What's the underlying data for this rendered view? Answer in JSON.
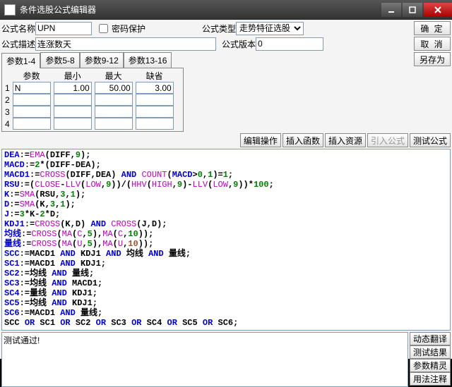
{
  "window_title": "条件选股公式编辑器",
  "top": {
    "name_label": "公式名称",
    "name_value": "UPN",
    "pwd_label": "密码保护",
    "type_label": "公式类型",
    "type_value": "走势特征选股",
    "desc_label": "公式描述",
    "desc_value": "连涨数天",
    "ver_label": "公式版本",
    "ver_value": "0"
  },
  "right_buttons": {
    "ok": "确 定",
    "cancel": "取 消",
    "saveas": "另存为"
  },
  "tabs": [
    "参数1-4",
    "参数5-8",
    "参数9-12",
    "参数13-16"
  ],
  "param_headers": [
    "参数",
    "最小",
    "最大",
    "缺省"
  ],
  "param_rows": [
    {
      "ix": "1",
      "name": "N",
      "min": "1.00",
      "max": "50.00",
      "def": "3.00"
    },
    {
      "ix": "2",
      "name": "",
      "min": "",
      "max": "",
      "def": ""
    },
    {
      "ix": "3",
      "name": "",
      "min": "",
      "max": "",
      "def": ""
    },
    {
      "ix": "4",
      "name": "",
      "min": "",
      "max": "",
      "def": ""
    }
  ],
  "mid_buttons": [
    "编辑操作",
    "插入函数",
    "插入资源",
    "引入公式",
    "测试公式"
  ],
  "mid_disabled_index": 3,
  "output_text": "测试通过!",
  "side_buttons": [
    "动态翻译",
    "测试结果",
    "参数精灵",
    "用法注释"
  ],
  "code_lines": [
    [
      [
        "kw",
        "DEA"
      ],
      [
        "bk",
        ":="
      ],
      [
        "fn",
        "EMA"
      ],
      [
        "bk",
        "(DIFF,"
      ],
      [
        "gn",
        "9"
      ],
      [
        "bk",
        ");"
      ]
    ],
    [
      [
        "kw",
        "MACD"
      ],
      [
        "bk",
        ":="
      ],
      [
        "gn",
        "2"
      ],
      [
        "bk",
        "*(DIFF-DEA);"
      ]
    ],
    [
      [
        "kw",
        "MACD1"
      ],
      [
        "bk",
        ":="
      ],
      [
        "fn",
        "CROSS"
      ],
      [
        "bk",
        "(DIFF,DEA) "
      ],
      [
        "kw",
        "AND"
      ],
      [
        "bk",
        " "
      ],
      [
        "fn",
        "COUNT"
      ],
      [
        "bk",
        "("
      ],
      [
        "kw",
        "MACD"
      ],
      [
        "bk",
        ">"
      ],
      [
        "gn",
        "0"
      ],
      [
        "bk",
        ","
      ],
      [
        "gn",
        "1"
      ],
      [
        "bk",
        ")="
      ],
      [
        "gn",
        "1"
      ],
      [
        "bk",
        ";"
      ]
    ],
    [
      [
        "kw",
        "RSU"
      ],
      [
        "bk",
        ":=("
      ],
      [
        "fn",
        "CLOSE"
      ],
      [
        "bk",
        "-"
      ],
      [
        "fn",
        "LLV"
      ],
      [
        "bk",
        "("
      ],
      [
        "fn",
        "LOW"
      ],
      [
        "bk",
        ","
      ],
      [
        "gn",
        "9"
      ],
      [
        "bk",
        "))/("
      ],
      [
        "fn",
        "HHV"
      ],
      [
        "bk",
        "("
      ],
      [
        "fn",
        "HIGH"
      ],
      [
        "bk",
        ","
      ],
      [
        "gn",
        "9"
      ],
      [
        "bk",
        ")-"
      ],
      [
        "fn",
        "LLV"
      ],
      [
        "bk",
        "("
      ],
      [
        "fn",
        "LOW"
      ],
      [
        "bk",
        ","
      ],
      [
        "gn",
        "9"
      ],
      [
        "bk",
        "))*"
      ],
      [
        "gn",
        "100"
      ],
      [
        "bk",
        ";"
      ]
    ],
    [
      [
        "kw",
        "K"
      ],
      [
        "bk",
        ":="
      ],
      [
        "fn",
        "SMA"
      ],
      [
        "bk",
        "(RSU,"
      ],
      [
        "gn",
        "3"
      ],
      [
        "bk",
        ","
      ],
      [
        "gn",
        "1"
      ],
      [
        "bk",
        ");"
      ]
    ],
    [
      [
        "kw",
        "D"
      ],
      [
        "bk",
        ":="
      ],
      [
        "fn",
        "SMA"
      ],
      [
        "bk",
        "(K,"
      ],
      [
        "gn",
        "3"
      ],
      [
        "bk",
        ","
      ],
      [
        "gn",
        "1"
      ],
      [
        "bk",
        ");"
      ]
    ],
    [
      [
        "kw",
        "J"
      ],
      [
        "bk",
        ":="
      ],
      [
        "gn",
        "3"
      ],
      [
        "bk",
        "*K-"
      ],
      [
        "gn",
        "2"
      ],
      [
        "bk",
        "*D;"
      ]
    ],
    [
      [
        "kw",
        "KDJ1"
      ],
      [
        "bk",
        ":="
      ],
      [
        "fn",
        "CROSS"
      ],
      [
        "bk",
        "(K,D) "
      ],
      [
        "kw",
        "AND"
      ],
      [
        "bk",
        " "
      ],
      [
        "fn",
        "CROSS"
      ],
      [
        "bk",
        "(J,D);"
      ]
    ],
    [
      [
        "kw",
        "均线"
      ],
      [
        "bk",
        ":="
      ],
      [
        "fn",
        "CROSS"
      ],
      [
        "bk",
        "("
      ],
      [
        "fn",
        "MA"
      ],
      [
        "bk",
        "("
      ],
      [
        "fn",
        "C"
      ],
      [
        "bk",
        ","
      ],
      [
        "gn",
        "5"
      ],
      [
        "bk",
        "),"
      ],
      [
        "fn",
        "MA"
      ],
      [
        "bk",
        "("
      ],
      [
        "fn",
        "C"
      ],
      [
        "bk",
        ","
      ],
      [
        "gn",
        "10"
      ],
      [
        "bk",
        "));"
      ]
    ],
    [
      [
        "kw",
        "量线"
      ],
      [
        "bk",
        ":="
      ],
      [
        "fn",
        "CROSS"
      ],
      [
        "bk",
        "("
      ],
      [
        "fn",
        "MA"
      ],
      [
        "bk",
        "("
      ],
      [
        "fn",
        "U"
      ],
      [
        "bk",
        ","
      ],
      [
        "gn",
        "5"
      ],
      [
        "bk",
        "),"
      ],
      [
        "fn",
        "MA"
      ],
      [
        "bk",
        "("
      ],
      [
        "fn",
        "U"
      ],
      [
        "bk",
        ","
      ],
      [
        "br",
        "10"
      ],
      [
        "bk",
        "));"
      ]
    ],
    [
      [
        "kw",
        "SCC"
      ],
      [
        "bk",
        ":=MACD1 "
      ],
      [
        "kw",
        "AND"
      ],
      [
        "bk",
        " KDJ1 "
      ],
      [
        "kw",
        "AND"
      ],
      [
        "bk",
        " 均线 "
      ],
      [
        "kw",
        "AND"
      ],
      [
        "bk",
        " 量线;"
      ]
    ],
    [
      [
        "kw",
        "SC1"
      ],
      [
        "bk",
        ":=MACD1 "
      ],
      [
        "kw",
        "AND"
      ],
      [
        "bk",
        " KDJ1;"
      ]
    ],
    [
      [
        "kw",
        "SC2"
      ],
      [
        "bk",
        ":=均线 "
      ],
      [
        "kw",
        "AND"
      ],
      [
        "bk",
        " 量线;"
      ]
    ],
    [
      [
        "kw",
        "SC3"
      ],
      [
        "bk",
        ":=均线 "
      ],
      [
        "kw",
        "AND"
      ],
      [
        "bk",
        " MACD1;"
      ]
    ],
    [
      [
        "kw",
        "SC4"
      ],
      [
        "bk",
        ":=量线 "
      ],
      [
        "kw",
        "AND"
      ],
      [
        "bk",
        " KDJ1;"
      ]
    ],
    [
      [
        "kw",
        "SC5"
      ],
      [
        "bk",
        ":=均线 "
      ],
      [
        "kw",
        "AND"
      ],
      [
        "bk",
        " KDJ1;"
      ]
    ],
    [
      [
        "kw",
        "SC6"
      ],
      [
        "bk",
        ":=MACD1 "
      ],
      [
        "kw",
        "AND"
      ],
      [
        "bk",
        " 量线;"
      ]
    ],
    [
      [
        "bk",
        "SCC "
      ],
      [
        "kw",
        "OR"
      ],
      [
        "bk",
        " SC1 "
      ],
      [
        "kw",
        "OR"
      ],
      [
        "bk",
        " SC2 "
      ],
      [
        "kw",
        "OR"
      ],
      [
        "bk",
        " SC3 "
      ],
      [
        "kw",
        "OR"
      ],
      [
        "bk",
        " SC4 "
      ],
      [
        "kw",
        "OR"
      ],
      [
        "bk",
        " SC5 "
      ],
      [
        "kw",
        "OR"
      ],
      [
        "bk",
        " SC6;"
      ]
    ]
  ]
}
